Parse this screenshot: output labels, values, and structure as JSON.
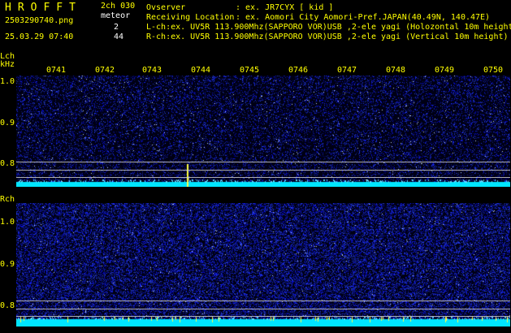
{
  "header": {
    "brand": "HROFFT",
    "file_name": "2503290740.png",
    "datetime": "25.03.29 07:40",
    "version": "2ch 030",
    "meteor_label": "meteor",
    "lch_count": "2",
    "rch_count": "44",
    "observer_label": "Ovserver",
    "observer_value": ": ex. JR7CYX [ kid ]",
    "location_label": "Receiving Location",
    "location_value": ": ex. Aomori City Aomori-Pref.JAPAN(40.49N, 140.47E)",
    "lch_line": "L-ch:ex. UV5R 113.900Mhz(SAPPORO VOR)USB ,2-ele yagi (Holozontal 10m height",
    "rch_line": "R-ch:ex. UV5R 113.900Mhz(SAPPORO VOR)USB ,2-ele yagi (Vertical 10m height)"
  },
  "lch": {
    "label": "Lch",
    "unit": "kHz",
    "y_ticks": [
      "1.0",
      "0.9",
      "0.8"
    ]
  },
  "rch": {
    "label": "Rch",
    "y_ticks": [
      "1.0",
      "0.9",
      "0.8"
    ]
  },
  "time_ticks": [
    "0741",
    "0742",
    "0743",
    "0744",
    "0745",
    "0746",
    "0747",
    "0748",
    "0749",
    "0750"
  ],
  "colors": {
    "background": "#000000",
    "label_yellow": "#ffff00",
    "noise_blue": "#1a2a9a",
    "baseline_cyan": "#00e5ff",
    "meteor_yellow": "#ffff40"
  }
}
